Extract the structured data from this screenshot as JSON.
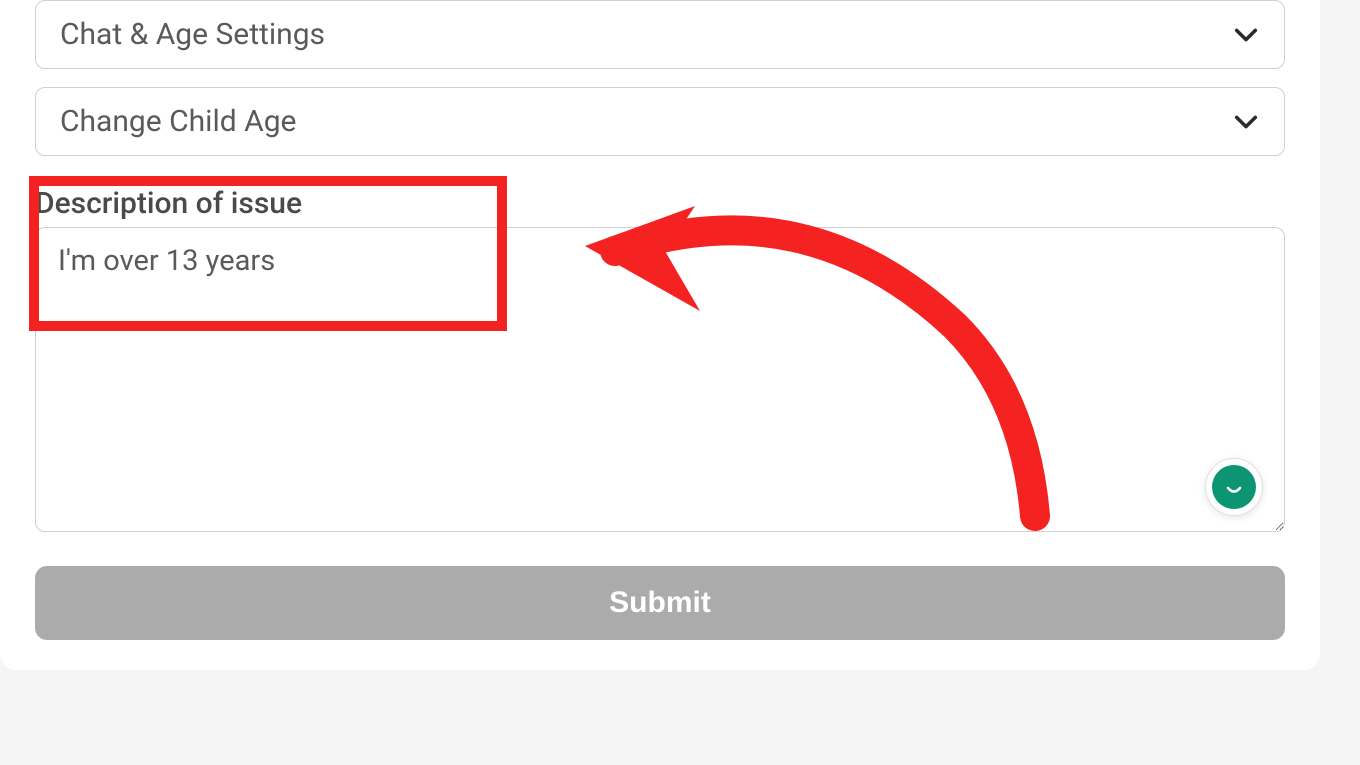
{
  "dropdowns": {
    "chat_age": "Chat & Age Settings",
    "change_child": "Change Child Age"
  },
  "description": {
    "label": "Description of issue",
    "value": "I'm over 13 years"
  },
  "submit": {
    "label": "Submit"
  },
  "annotation": {
    "highlight_color": "#f52222"
  },
  "chat_widget": {
    "background": "#0d9573"
  }
}
